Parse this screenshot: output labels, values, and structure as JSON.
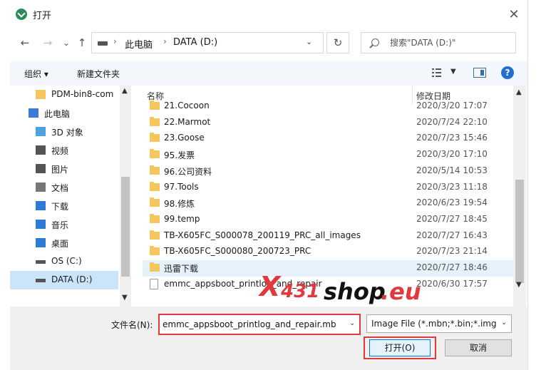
{
  "window": {
    "title": "打开",
    "close_glyph": "✕"
  },
  "nav": {
    "back": "←",
    "forward": "→",
    "recent": "⌄",
    "up": "↑",
    "path": [
      "此电脑",
      "DATA (D:)"
    ],
    "path_sep": "›",
    "refresh": "↻",
    "search_placeholder": "搜索\"DATA (D:)\""
  },
  "toolbar": {
    "organize": "组织 ▾",
    "new_folder": "新建文件夹",
    "help": "?"
  },
  "sidebar": {
    "items": [
      {
        "label": "PDM-bin8-com",
        "icon": "folder-icon",
        "indent": 1
      },
      {
        "label": "此电脑",
        "icon": "computer-icon",
        "indent": 0
      },
      {
        "label": "3D 对象",
        "icon": "3d-objects-icon",
        "indent": 1
      },
      {
        "label": "视频",
        "icon": "video-icon",
        "indent": 1
      },
      {
        "label": "图片",
        "icon": "pictures-icon",
        "indent": 1
      },
      {
        "label": "文档",
        "icon": "documents-icon",
        "indent": 1
      },
      {
        "label": "下载",
        "icon": "download-icon",
        "indent": 1
      },
      {
        "label": "音乐",
        "icon": "music-icon",
        "indent": 1
      },
      {
        "label": "桌面",
        "icon": "desktop-icon",
        "indent": 1
      },
      {
        "label": "OS (C:)",
        "icon": "drive-c-icon",
        "indent": 1
      },
      {
        "label": "DATA (D:)",
        "icon": "drive-d-icon",
        "indent": 1,
        "selected": true
      }
    ]
  },
  "files": {
    "columns": {
      "name": "名称",
      "date": "修改日期"
    },
    "rows": [
      {
        "name": "21.Cocoon",
        "date": "2020/3/20 17:07",
        "type": "folder"
      },
      {
        "name": "22.Marmot",
        "date": "2020/7/24 22:10",
        "type": "folder"
      },
      {
        "name": "23.Goose",
        "date": "2020/7/23 15:46",
        "type": "folder"
      },
      {
        "name": "95.发票",
        "date": "2020/3/20 17:10",
        "type": "folder"
      },
      {
        "name": "96.公司资料",
        "date": "2020/5/14 10:53",
        "type": "folder"
      },
      {
        "name": "97.Tools",
        "date": "2020/3/23 11:18",
        "type": "folder"
      },
      {
        "name": "98.修炼",
        "date": "2020/6/23 19:54",
        "type": "folder"
      },
      {
        "name": "99.temp",
        "date": "2020/7/27 18:45",
        "type": "folder"
      },
      {
        "name": "TB-X605FC_S000078_200119_PRC_all_images",
        "date": "2020/7/27 16:43",
        "type": "folder"
      },
      {
        "name": "TB-X605FC_S000080_200723_PRC",
        "date": "2020/7/23 21:14",
        "type": "folder"
      },
      {
        "name": "迅雷下载",
        "date": "2020/7/27 18:46",
        "type": "folder",
        "highlight": true
      },
      {
        "name": "emmc_appsboot_printlog_and_repair",
        "date": "2020/6/30 17:57",
        "type": "file"
      }
    ]
  },
  "bottom": {
    "filename_label": "文件名(N):",
    "filename_value": "emmc_appsboot_printlog_and_repair.mb",
    "filetype_value": "Image File (*.mbn;*.bin;*.img",
    "open_label": "打开(O)",
    "cancel_label": "取消"
  },
  "watermark": {
    "x": "X",
    "num": "431",
    "shop": "shop",
    "eu": ".eu"
  },
  "colors": {
    "accent": "#0078d7",
    "highlight_border": "#e0393e",
    "folder": "#f5c65c",
    "selection": "#cce4f7"
  }
}
